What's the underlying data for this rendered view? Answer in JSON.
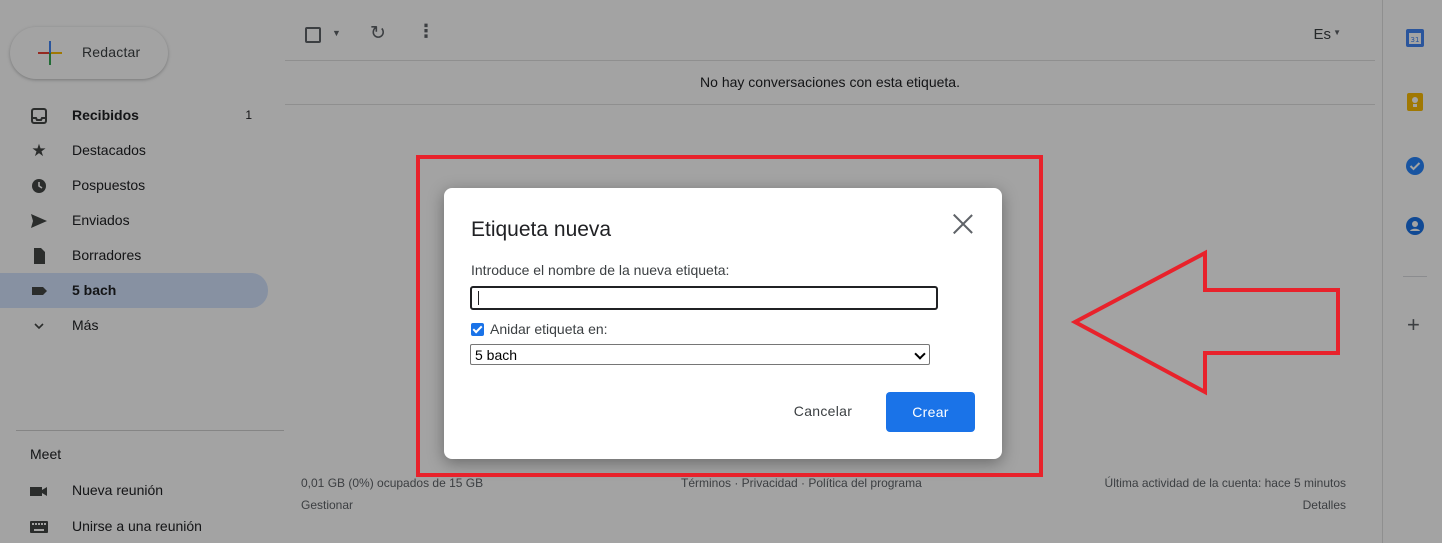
{
  "compose": {
    "label": "Redactar"
  },
  "nav": {
    "items": [
      {
        "label": "Recibidos",
        "count": "1",
        "icon": "inbox-icon"
      },
      {
        "label": "Destacados",
        "icon": "star-icon"
      },
      {
        "label": "Pospuestos",
        "icon": "clock-icon"
      },
      {
        "label": "Enviados",
        "icon": "send-icon"
      },
      {
        "label": "Borradores",
        "icon": "draft-icon"
      },
      {
        "label": "5 bach",
        "icon": "label-icon"
      },
      {
        "label": "Más",
        "icon": "chevron-down-icon"
      }
    ]
  },
  "meet": {
    "title": "Meet",
    "new_meeting": "Nueva reunión",
    "join_meeting": "Unirse a una reunión"
  },
  "toolbar": {
    "language": "Es"
  },
  "main": {
    "empty_message": "No hay conversaciones con esta etiqueta."
  },
  "footer": {
    "storage": "0,01 GB (0%) ocupados de 15 GB",
    "manage": "Gestionar",
    "links": "Términos · Privacidad · Política del programa",
    "activity": "Última actividad de la cuenta: hace 5 minutos",
    "details": "Detalles"
  },
  "dialog": {
    "title": "Etiqueta nueva",
    "name_label": "Introduce el nombre de la nueva etiqueta:",
    "name_value": "",
    "nest_label": "Anidar etiqueta en:",
    "nest_checked": true,
    "nest_selected": "5 bach",
    "cancel_label": "Cancelar",
    "create_label": "Crear"
  },
  "colors": {
    "accent": "#1a73e8",
    "annotation": "#e8222b",
    "active_nav": "#d3e3fd"
  }
}
